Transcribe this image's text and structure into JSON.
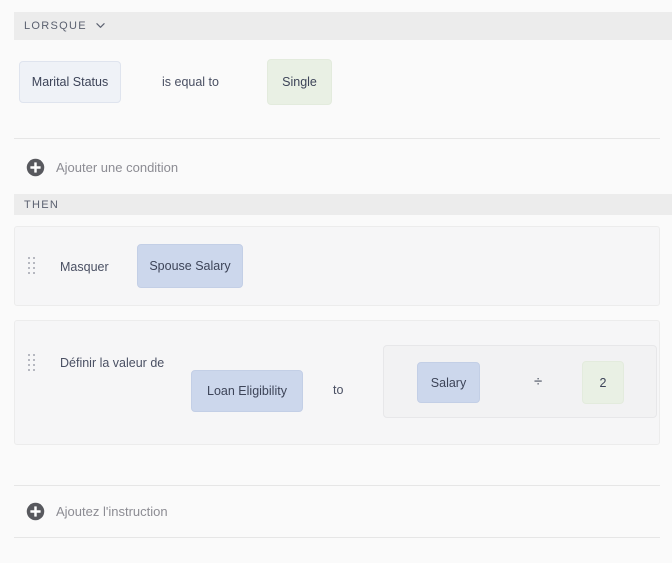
{
  "when_section": {
    "label": "LORSQUE",
    "chevron_icon": "chevron-down-icon",
    "condition": {
      "field_chip": "Marital Status",
      "operator_text": "is equal to",
      "value_chip": "Single"
    },
    "add_condition": {
      "icon": "plus-circle-icon",
      "label": "Ajouter une condition"
    }
  },
  "then_section": {
    "label": "THEN",
    "actions": [
      {
        "drag_handle_icon": "drag-handle-icon",
        "verb": "Masquer",
        "target_chip": "Spouse Salary"
      },
      {
        "drag_handle_icon": "drag-handle-icon",
        "verb": "Définir la valeur de",
        "target_chip": "Loan Eligibility",
        "connector": "to",
        "formula": {
          "operand_left": "Salary",
          "operator": "÷",
          "operator_icon": "division-icon",
          "operand_right": "2"
        }
      }
    ],
    "add_instruction": {
      "icon": "plus-circle-icon",
      "label": "Ajoutez l'instruction"
    }
  },
  "colors": {
    "page_background": "#fafafa",
    "band_background": "#ececec",
    "card_background": "#f6f6f7",
    "chip_field_blue": "#ccd7ec",
    "chip_field_light": "#eff2f7",
    "chip_value_green": "#e9f0e4",
    "text_primary": "#3d4458",
    "text_muted": "#8c8c93"
  }
}
